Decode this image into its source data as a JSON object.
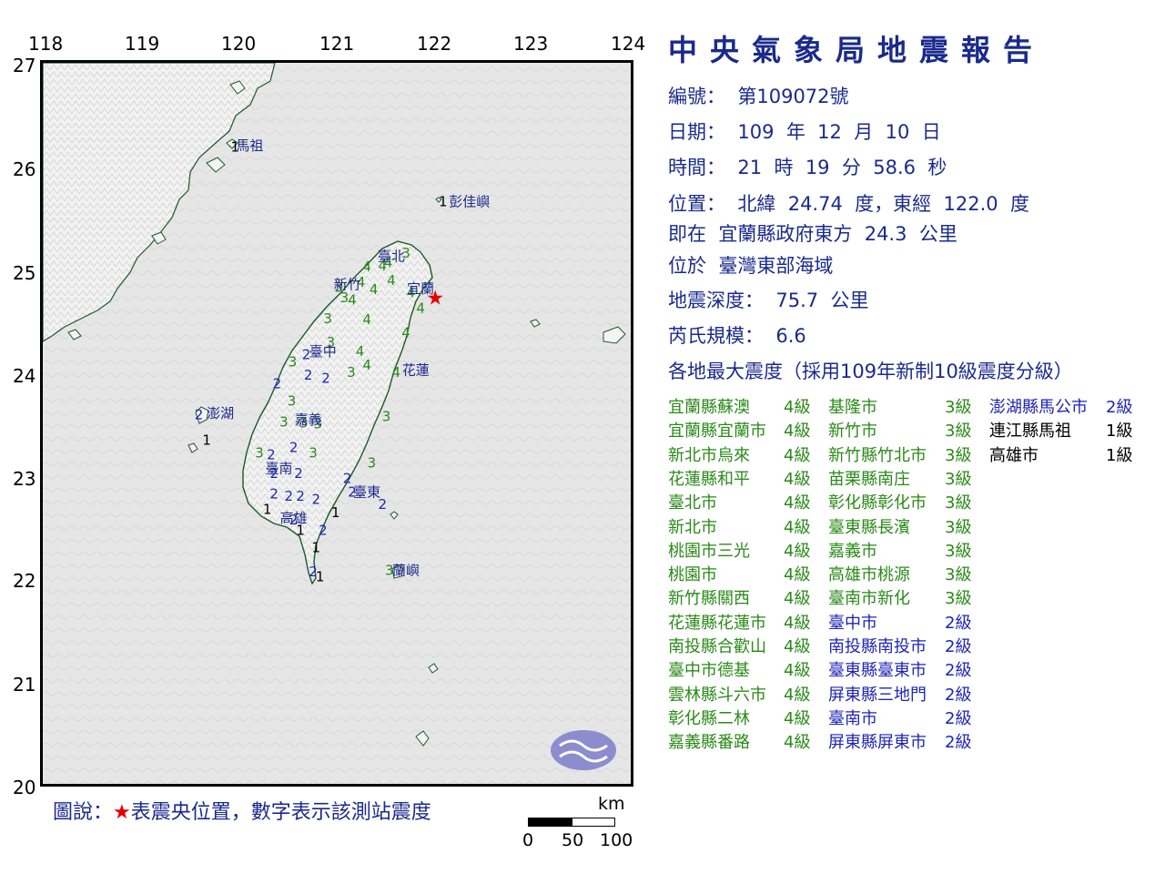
{
  "report": {
    "title": "中央氣象局地震報告",
    "number_label": "編號：",
    "number": "第109072號",
    "date_label": "日期：",
    "date_year": "109",
    "date_year_unit": "年",
    "date_month": "12",
    "date_month_unit": "月",
    "date_day": "10",
    "date_day_unit": "日",
    "time_label": "時間：",
    "time_hour": "21",
    "time_hour_unit": "時",
    "time_min": "19",
    "time_min_unit": "分",
    "time_sec": "58.6",
    "time_sec_unit": "秒",
    "position_label": "位置：",
    "position_text": "北緯  24.74  度，東經  122.0  度",
    "relative_prefix": "即在",
    "relative_text": "宜蘭縣政府東方  24.3  公里",
    "region_prefix": "位於",
    "region_text": "臺灣東部海域",
    "depth_label": "地震深度：",
    "depth_value": "75.7",
    "depth_unit": "公里",
    "magnitude_label": "芮氏規模：",
    "magnitude_value": "6.6",
    "intensity_heading": "各地最大震度（採用109年新制10級震度分級）"
  },
  "intensity_columns": [
    [
      {
        "station": "宜蘭縣蘇澳",
        "level": "4級",
        "color": "#2a8a18"
      },
      {
        "station": "宜蘭縣宜蘭市",
        "level": "4級",
        "color": "#2a8a18"
      },
      {
        "station": "新北市烏來",
        "level": "4級",
        "color": "#2a8a18"
      },
      {
        "station": "花蓮縣和平",
        "level": "4級",
        "color": "#2a8a18"
      },
      {
        "station": "臺北市",
        "level": "4級",
        "color": "#2a8a18"
      },
      {
        "station": "新北市",
        "level": "4級",
        "color": "#2a8a18"
      },
      {
        "station": "桃園市三光",
        "level": "4級",
        "color": "#2a8a18"
      },
      {
        "station": "桃園市",
        "level": "4級",
        "color": "#2a8a18"
      },
      {
        "station": "新竹縣關西",
        "level": "4級",
        "color": "#2a8a18"
      },
      {
        "station": "花蓮縣花蓮市",
        "level": "4級",
        "color": "#2a8a18"
      },
      {
        "station": "南投縣合歡山",
        "level": "4級",
        "color": "#2a8a18"
      },
      {
        "station": "臺中市德基",
        "level": "4級",
        "color": "#2a8a18"
      },
      {
        "station": "雲林縣斗六市",
        "level": "4級",
        "color": "#2a8a18"
      },
      {
        "station": "彰化縣二林",
        "level": "4級",
        "color": "#2a8a18"
      },
      {
        "station": "嘉義縣番路",
        "level": "4級",
        "color": "#2a8a18"
      }
    ],
    [
      {
        "station": "基隆市",
        "level": "3級",
        "color": "#2a8a18"
      },
      {
        "station": "新竹市",
        "level": "3級",
        "color": "#2a8a18"
      },
      {
        "station": "新竹縣竹北市",
        "level": "3級",
        "color": "#2a8a18"
      },
      {
        "station": "苗栗縣南庄",
        "level": "3級",
        "color": "#2a8a18"
      },
      {
        "station": "彰化縣彰化市",
        "level": "3級",
        "color": "#2a8a18"
      },
      {
        "station": "臺東縣長濱",
        "level": "3級",
        "color": "#2a8a18"
      },
      {
        "station": "嘉義市",
        "level": "3級",
        "color": "#2a8a18"
      },
      {
        "station": "高雄市桃源",
        "level": "3級",
        "color": "#2a8a18"
      },
      {
        "station": "臺南市新化",
        "level": "3級",
        "color": "#2a8a18"
      },
      {
        "station": "臺中市",
        "level": "2級",
        "color": "#1e24b8"
      },
      {
        "station": "南投縣南投市",
        "level": "2級",
        "color": "#1e24b8"
      },
      {
        "station": "臺東縣臺東市",
        "level": "2級",
        "color": "#1e24b8"
      },
      {
        "station": "屏東縣三地門",
        "level": "2級",
        "color": "#1e24b8"
      },
      {
        "station": "臺南市",
        "level": "2級",
        "color": "#1e24b8"
      },
      {
        "station": "屏東縣屏東市",
        "level": "2級",
        "color": "#1e24b8"
      }
    ],
    [
      {
        "station": "澎湖縣馬公市",
        "level": "2級",
        "color": "#1e24b8"
      },
      {
        "station": "連江縣馬祖",
        "level": "1級",
        "color": "#000000"
      },
      {
        "station": "高雄市",
        "level": "1級",
        "color": "#000000"
      }
    ]
  ],
  "axes": {
    "lon_ticks": [
      "118",
      "119",
      "120",
      "121",
      "122",
      "123",
      "124"
    ],
    "lat_ticks": [
      "27",
      "26",
      "25",
      "24",
      "23",
      "22",
      "21",
      "20"
    ]
  },
  "map_labels": {
    "matsu": "馬祖",
    "pengjia": "彭佳嶼",
    "taipei": "臺北",
    "hsinchu": "新竹",
    "yilan": "宜蘭",
    "taichung": "臺中",
    "hualien": "花蓮",
    "penghu": "澎湖",
    "chiayi": "嘉義",
    "tainan": "臺南",
    "taitung": "臺東",
    "kaohsiung": "高雄",
    "lanyu": "蘭嶼"
  },
  "map_stations": [
    {
      "lon": 119.95,
      "lat": 26.16,
      "v": "1"
    },
    {
      "lon": 122.08,
      "lat": 25.63,
      "v": "1"
    },
    {
      "lon": 121.7,
      "lat": 25.13,
      "v": "3"
    },
    {
      "lon": 121.52,
      "lat": 25.04,
      "v": "4"
    },
    {
      "lon": 121.46,
      "lat": 25.01,
      "v": "4"
    },
    {
      "lon": 121.3,
      "lat": 25.0,
      "v": "4"
    },
    {
      "lon": 121.55,
      "lat": 24.87,
      "v": "4"
    },
    {
      "lon": 121.24,
      "lat": 24.85,
      "v": "4"
    },
    {
      "lon": 121.37,
      "lat": 24.78,
      "v": "4"
    },
    {
      "lon": 121.01,
      "lat": 24.8,
      "v": "3"
    },
    {
      "lon": 121.07,
      "lat": 24.7,
      "v": "3"
    },
    {
      "lon": 121.15,
      "lat": 24.68,
      "v": "4"
    },
    {
      "lon": 121.75,
      "lat": 24.75,
      "v": "4"
    },
    {
      "lon": 121.85,
      "lat": 24.6,
      "v": "4"
    },
    {
      "lon": 121.7,
      "lat": 24.36,
      "v": "4"
    },
    {
      "lon": 121.3,
      "lat": 24.49,
      "v": "4"
    },
    {
      "lon": 120.9,
      "lat": 24.5,
      "v": "3"
    },
    {
      "lon": 120.68,
      "lat": 24.15,
      "v": "2"
    },
    {
      "lon": 120.93,
      "lat": 24.27,
      "v": "3"
    },
    {
      "lon": 121.23,
      "lat": 24.18,
      "v": "4"
    },
    {
      "lon": 121.3,
      "lat": 24.05,
      "v": "4"
    },
    {
      "lon": 121.6,
      "lat": 23.98,
      "v": "4"
    },
    {
      "lon": 120.54,
      "lat": 24.08,
      "v": "3"
    },
    {
      "lon": 120.7,
      "lat": 23.95,
      "v": "2"
    },
    {
      "lon": 120.88,
      "lat": 23.92,
      "v": "2"
    },
    {
      "lon": 121.14,
      "lat": 23.98,
      "v": "3"
    },
    {
      "lon": 121.5,
      "lat": 23.55,
      "v": "3"
    },
    {
      "lon": 120.38,
      "lat": 23.87,
      "v": "2"
    },
    {
      "lon": 120.53,
      "lat": 23.7,
      "v": "3"
    },
    {
      "lon": 120.45,
      "lat": 23.5,
      "v": "3"
    },
    {
      "lon": 120.65,
      "lat": 23.49,
      "v": "3"
    },
    {
      "lon": 120.8,
      "lat": 23.48,
      "v": "3"
    },
    {
      "lon": 121.35,
      "lat": 23.1,
      "v": "3"
    },
    {
      "lon": 119.58,
      "lat": 23.57,
      "v": "2"
    },
    {
      "lon": 119.66,
      "lat": 23.32,
      "v": "1"
    },
    {
      "lon": 120.2,
      "lat": 23.2,
      "v": "3"
    },
    {
      "lon": 120.32,
      "lat": 23.18,
      "v": "2"
    },
    {
      "lon": 120.55,
      "lat": 23.25,
      "v": "2"
    },
    {
      "lon": 120.75,
      "lat": 23.2,
      "v": "3"
    },
    {
      "lon": 120.35,
      "lat": 23.0,
      "v": "2"
    },
    {
      "lon": 120.6,
      "lat": 23.0,
      "v": "2"
    },
    {
      "lon": 121.1,
      "lat": 22.95,
      "v": "2"
    },
    {
      "lon": 121.15,
      "lat": 22.82,
      "v": "2"
    },
    {
      "lon": 120.35,
      "lat": 22.8,
      "v": "2"
    },
    {
      "lon": 120.5,
      "lat": 22.78,
      "v": "2"
    },
    {
      "lon": 120.62,
      "lat": 22.78,
      "v": "2"
    },
    {
      "lon": 120.78,
      "lat": 22.75,
      "v": "2"
    },
    {
      "lon": 121.46,
      "lat": 22.7,
      "v": "2"
    },
    {
      "lon": 120.28,
      "lat": 22.65,
      "v": "1"
    },
    {
      "lon": 120.55,
      "lat": 22.55,
      "v": "2"
    },
    {
      "lon": 120.98,
      "lat": 22.62,
      "v": "1"
    },
    {
      "lon": 120.62,
      "lat": 22.45,
      "v": "1"
    },
    {
      "lon": 120.85,
      "lat": 22.45,
      "v": "2"
    },
    {
      "lon": 120.78,
      "lat": 22.28,
      "v": "1"
    },
    {
      "lon": 120.75,
      "lat": 22.05,
      "v": "2"
    },
    {
      "lon": 120.82,
      "lat": 22.0,
      "v": "1"
    },
    {
      "lon": 121.53,
      "lat": 22.06,
      "v": "3"
    }
  ],
  "epicenter": {
    "lon": 122.0,
    "lat": 24.74
  },
  "legend": {
    "prefix": "圖說：",
    "star": "★",
    "text": "表震央位置，數字表示該測站震度"
  },
  "scale_bar": {
    "unit": "km",
    "labels": [
      "0",
      "50",
      "100"
    ]
  },
  "colors": {
    "title": "#1a2a8c",
    "green": "#2a8a18",
    "blue": "#1e24b8",
    "star": "#e60000",
    "land": "#f4f4f4",
    "sea": "#e6e6e6"
  }
}
